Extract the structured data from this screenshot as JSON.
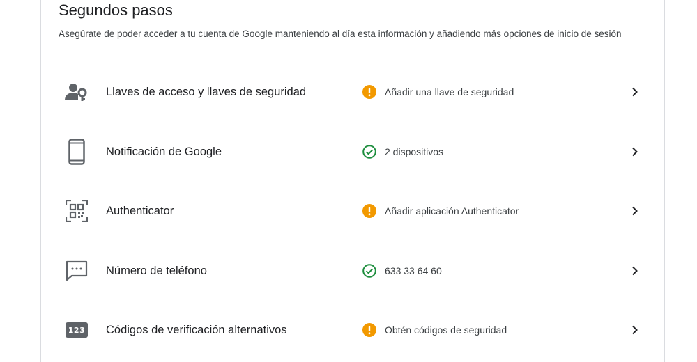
{
  "section": {
    "title": "Segundos pasos",
    "description": "Asegúrate de poder acceder a tu cuenta de Google manteniendo al día esta información y añadiendo más opciones de inicio de sesión"
  },
  "items": [
    {
      "label": "Llaves de acceso y llaves de seguridad",
      "icon": "person-key-icon",
      "status_icon": "warning-icon",
      "status_color": "#f29900",
      "status": "Añadir una llave de seguridad"
    },
    {
      "label": "Notificación de Google",
      "icon": "phone-icon",
      "status_icon": "check-circle-icon",
      "status_color": "#1e8e3e",
      "status": "2 dispositivos"
    },
    {
      "label": "Authenticator",
      "icon": "qr-code-icon",
      "status_icon": "warning-icon",
      "status_color": "#f29900",
      "status": "Añadir aplicación Authenticator"
    },
    {
      "label": "Número de teléfono",
      "icon": "sms-icon",
      "status_icon": "check-circle-icon",
      "status_color": "#1e8e3e",
      "status": "633 33 64 60"
    },
    {
      "label": "Códigos de verificación alternativos",
      "icon": "backup-codes-icon",
      "icon_text": "123",
      "status_icon": "warning-icon",
      "status_color": "#f29900",
      "status": "Obtén códigos de seguridad"
    }
  ]
}
